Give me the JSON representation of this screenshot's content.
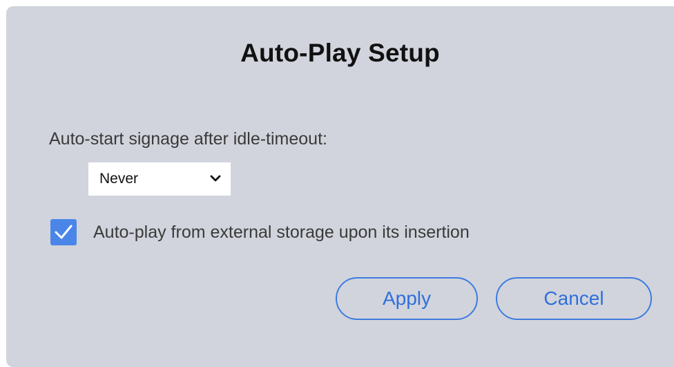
{
  "dialog": {
    "title": "Auto-Play Setup",
    "idle_label": "Auto-start signage after idle-timeout:",
    "idle_select": {
      "value": "Never",
      "icon": "chevron-down-icon"
    },
    "external_storage": {
      "checked": true,
      "label": "Auto-play from external storage upon its insertion",
      "icon": "checkmark-icon"
    },
    "buttons": {
      "apply": "Apply",
      "cancel": "Cancel"
    }
  },
  "colors": {
    "dialog_bg": "#d1d4dc",
    "accent": "#4a86e8",
    "button_text": "#2f6fdc"
  }
}
